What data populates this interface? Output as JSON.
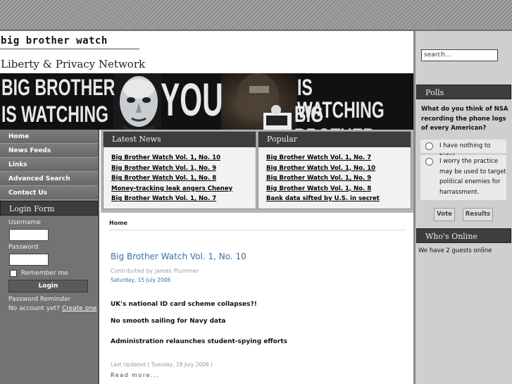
{
  "site": {
    "title": "big brother watch",
    "tagline": "Liberty & Privacy Network"
  },
  "banner": {
    "line1": "BIG BROTHER",
    "line2": "IS WATCHING",
    "center": "YOU",
    "line3": "IS WATCHING",
    "line4": "BIG BROTHER"
  },
  "menu": {
    "items": [
      {
        "label": "Home"
      },
      {
        "label": "News Feeds"
      },
      {
        "label": "Links"
      },
      {
        "label": "Advanced Search"
      },
      {
        "label": "Contact Us"
      }
    ]
  },
  "login": {
    "heading": "Login Form",
    "username_label": "Username",
    "password_label": "Password",
    "remember_label": "Remember me",
    "button": "Login",
    "reminder": "Password Reminder",
    "no_account": "No account yet?",
    "create": "Create one"
  },
  "latest_news": {
    "heading": "Latest News",
    "items": [
      "Big Brother Watch Vol. 1, No. 10",
      "Big Brother Watch Vol. 1, No. 9",
      "Big Brother Watch Vol. 1, No. 8",
      "Money-tracking leak angers Cheney",
      "Big Brother Watch Vol. 1, No. 7"
    ]
  },
  "popular": {
    "heading": "Popular",
    "items": [
      "Big Brother Watch Vol. 1, No. 7",
      "Big Brother Watch Vol. 1, No. 10",
      "Big Brother Watch Vol. 1, No. 9",
      "Big Brother Watch Vol. 1, No. 8",
      "Bank data sifted by U.S. in secret"
    ]
  },
  "breadcrumb": "Home",
  "article": {
    "title": "Big Brother Watch Vol. 1, No. 10",
    "author": "Contributed by James Plummer",
    "date": "Saturday, 15 July 2006",
    "lines": [
      "UK's national ID card scheme collapses?!",
      "No smooth sailing for Navy data",
      "Administration relaunches student-spying efforts"
    ],
    "last_updated": "Last Updated ( Tuesday, 18 July 2006 )",
    "read_more": "Read more..."
  },
  "search": {
    "placeholder": "search..."
  },
  "polls": {
    "heading": "Polls",
    "question": "What do you think of NSA recording the phone logs of every American?",
    "options": [
      "I have nothing to hide!",
      "I worry the practice may be used to target political enemies for harrassment."
    ],
    "vote": "Vote",
    "results": "Results"
  },
  "online": {
    "heading": "Who's Online",
    "text": "We have 2 guests online"
  },
  "colors": {
    "link_blue": "#3a6ea5",
    "module_header": "#3d3d3d",
    "sidebar": "#737373",
    "right_sidebar": "#cfcfcf"
  }
}
